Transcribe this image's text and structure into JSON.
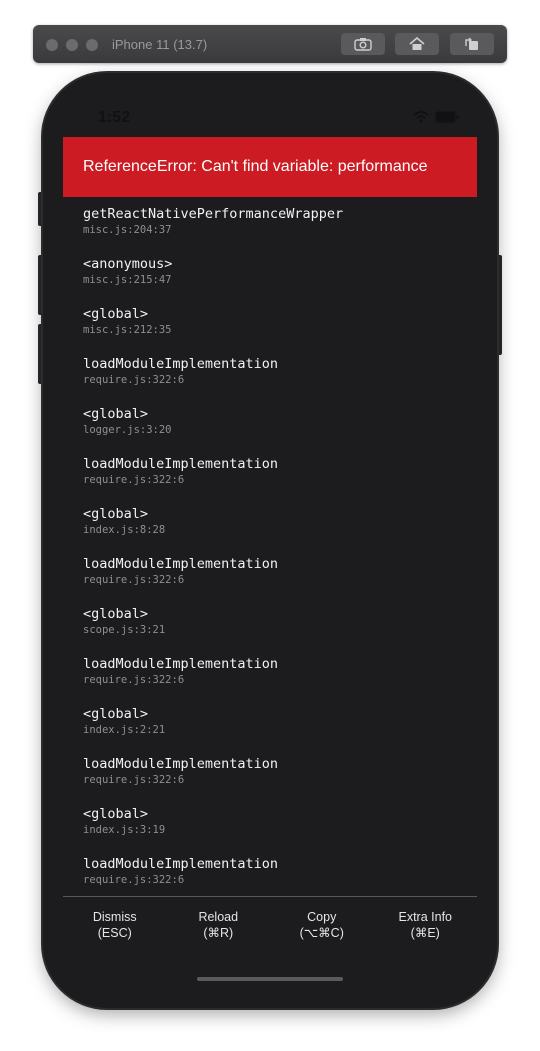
{
  "simulator": {
    "device_title": "iPhone 11 (13.7)",
    "buttons": [
      {
        "icon": "camera-icon"
      },
      {
        "icon": "home-icon"
      },
      {
        "icon": "rotate-icon"
      }
    ]
  },
  "status_bar": {
    "time": "1:52"
  },
  "error": {
    "title": "ReferenceError: Can't find variable: performance",
    "background_color": "#cc1b22"
  },
  "stack": [
    {
      "fn": "getReactNativePerformanceWrapper",
      "loc": "misc.js:204:37"
    },
    {
      "fn": "<anonymous>",
      "loc": "misc.js:215:47"
    },
    {
      "fn": "<global>",
      "loc": "misc.js:212:35"
    },
    {
      "fn": "loadModuleImplementation",
      "loc": "require.js:322:6"
    },
    {
      "fn": "<global>",
      "loc": "logger.js:3:20"
    },
    {
      "fn": "loadModuleImplementation",
      "loc": "require.js:322:6"
    },
    {
      "fn": "<global>",
      "loc": "index.js:8:28"
    },
    {
      "fn": "loadModuleImplementation",
      "loc": "require.js:322:6"
    },
    {
      "fn": "<global>",
      "loc": "scope.js:3:21"
    },
    {
      "fn": "loadModuleImplementation",
      "loc": "require.js:322:6"
    },
    {
      "fn": "<global>",
      "loc": "index.js:2:21"
    },
    {
      "fn": "loadModuleImplementation",
      "loc": "require.js:322:6"
    },
    {
      "fn": "<global>",
      "loc": "index.js:3:19"
    },
    {
      "fn": "loadModuleImplementation",
      "loc": "require.js:322:6"
    }
  ],
  "footer": [
    {
      "label": "Dismiss",
      "shortcut": "(ESC)"
    },
    {
      "label": "Reload",
      "shortcut": "(⌘R)"
    },
    {
      "label": "Copy",
      "shortcut": "(⌥⌘C)"
    },
    {
      "label": "Extra Info",
      "shortcut": "(⌘E)"
    }
  ]
}
